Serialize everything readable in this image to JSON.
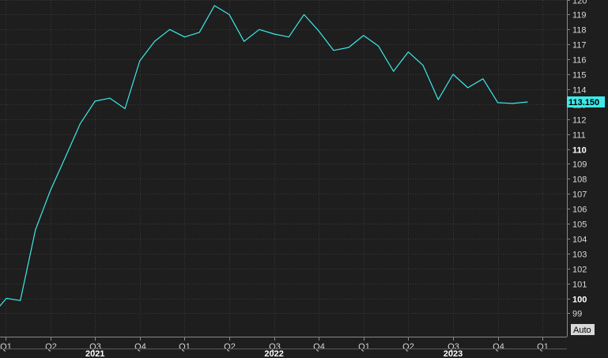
{
  "chart_data": {
    "type": "line",
    "title": "",
    "xlabel": "",
    "ylabel": "",
    "ylim": [
      98.1,
      120.5
    ],
    "xlim": [
      -0.3,
      12.5
    ],
    "grid": true,
    "y_ticks": [
      99,
      100,
      101,
      102,
      103,
      104,
      105,
      106,
      107,
      108,
      109,
      110,
      111,
      112,
      113,
      114,
      115,
      116,
      117,
      118,
      119,
      120
    ],
    "y_major_ticks": [
      100,
      110
    ],
    "x_ticks": [
      {
        "label": "Q1",
        "x": 0
      },
      {
        "label": "Q2",
        "x": 1
      },
      {
        "label": "Q3",
        "x": 2
      },
      {
        "label": "Q4",
        "x": 3
      },
      {
        "label": "Q1",
        "x": 4
      },
      {
        "label": "Q2",
        "x": 5
      },
      {
        "label": "Q3",
        "x": 6
      },
      {
        "label": "Q4",
        "x": 7
      },
      {
        "label": "Q1",
        "x": 8
      },
      {
        "label": "Q2",
        "x": 9
      },
      {
        "label": "Q3",
        "x": 10
      },
      {
        "label": "Q4",
        "x": 11
      },
      {
        "label": "Q1",
        "x": 12
      }
    ],
    "years": [
      {
        "label": "2021",
        "x": 2
      },
      {
        "label": "2022",
        "x": 6
      },
      {
        "label": "2023",
        "x": 10
      }
    ],
    "last_value_label": "113.150",
    "auto_label": "Auto",
    "series": [
      {
        "color": "#3ee8e8",
        "x": [
          -0.15,
          0.02,
          0.33,
          0.67,
          1.0,
          1.33,
          1.67,
          2.0,
          2.33,
          2.67,
          3.0,
          3.33,
          3.67,
          4.0,
          4.33,
          4.67,
          5.0,
          5.33,
          5.67,
          6.0,
          6.33,
          6.67,
          7.0,
          7.33,
          7.67,
          8.0,
          8.33,
          8.67,
          9.0,
          9.33,
          9.67,
          10.0,
          10.33,
          10.67,
          11.0,
          11.33,
          11.67
        ],
        "y": [
          99.4,
          100.0,
          99.85,
          104.6,
          107.2,
          109.4,
          111.7,
          113.2,
          113.4,
          112.7,
          115.9,
          117.2,
          118.0,
          117.5,
          117.8,
          119.6,
          119.0,
          117.2,
          118.0,
          117.7,
          117.5,
          119.0,
          117.9,
          116.6,
          116.8,
          117.6,
          116.9,
          115.2,
          116.5,
          115.6,
          113.3,
          115.0,
          114.1,
          114.7,
          113.1,
          113.05,
          113.15
        ]
      }
    ]
  }
}
